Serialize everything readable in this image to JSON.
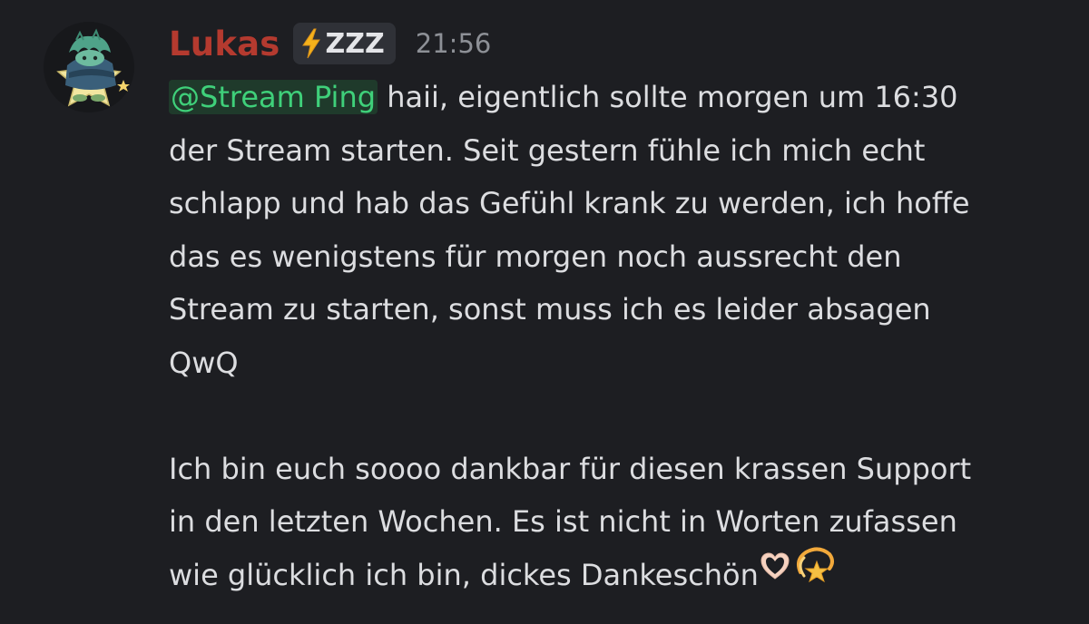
{
  "message": {
    "author": "Lukas",
    "tag": "ZZZ",
    "timestamp": "21:56",
    "mention": "@Stream Ping",
    "lines": [
      " haii, eigentlich sollte morgen um 16:30",
      "der Stream starten. Seit gestern fühle ich mich echt",
      "schlapp und hab das Gefühl krank zu werden, ich hoffe",
      "das es wenigstens für morgen noch aussrecht den",
      "Stream zu starten, sonst muss ich es leider absagen",
      "QwQ",
      "",
      "Ich bin euch soooo dankbar für diesen krassen Support",
      "in den letzten Wochen. Es ist nicht in Worten zufassen",
      "wie glücklich ich bin, dickes Dankeschön"
    ],
    "emojis": [
      "heart-hands-icon",
      "dizzy-star-icon"
    ]
  },
  "colors": {
    "background": "#1d1e22",
    "username": "#b43a2f",
    "mention_text": "#3fd07a",
    "mention_bg": "#1f3a2b",
    "timestamp": "#8d9096"
  }
}
